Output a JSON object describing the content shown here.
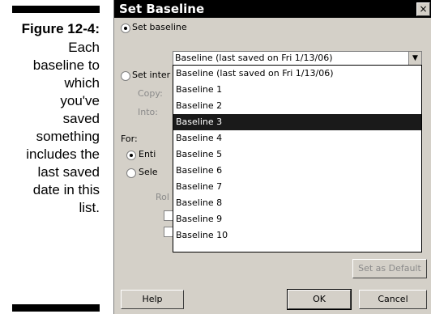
{
  "caption": {
    "figure_label": "Figure 12-4:",
    "text": "Each\nbaseline to\nwhich\nyou've\nsaved\nsomething\nincludes the\nlast saved\ndate in this\nlist."
  },
  "dialog": {
    "title": "Set Baseline",
    "close_glyph": "×",
    "set_baseline_label": "Set baseline",
    "set_interim_label": "Set inter",
    "copy_label": "Copy:",
    "into_label": "Into:",
    "for_label": "For:",
    "entire_label": "Enti",
    "selected_label": "Sele",
    "rollup_label": "Rol",
    "combo_value": "Baseline (last saved on Fri 1/13/06)",
    "combo_arrow": "▼",
    "baseline_list": [
      "Baseline (last saved on Fri 1/13/06)",
      "Baseline 1",
      "Baseline 2",
      "Baseline 3",
      "Baseline 4",
      "Baseline 5",
      "Baseline 6",
      "Baseline 7",
      "Baseline 8",
      "Baseline 9",
      "Baseline 10"
    ],
    "selected_index": 3,
    "set_default_label": "Set as Default",
    "help_label": "Help",
    "ok_label": "OK",
    "cancel_label": "Cancel"
  }
}
